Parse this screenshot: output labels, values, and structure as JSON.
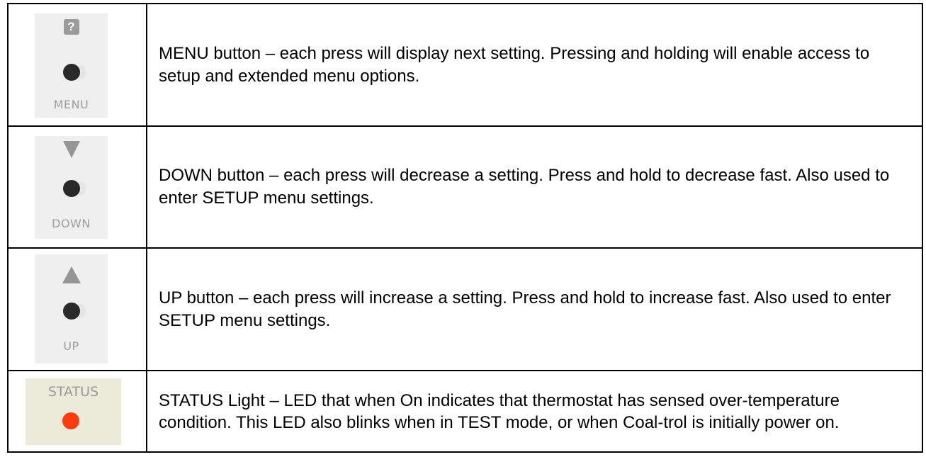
{
  "rows": [
    {
      "icon": "question-icon",
      "panel_label": "MENU",
      "description": "MENU button – each press will display next setting. Pressing and holding will enable access to setup and extended menu options."
    },
    {
      "icon": "down-triangle-icon",
      "panel_label": "DOWN",
      "description": "DOWN button – each press will decrease a setting. Press and hold to decrease fast. Also used to enter SETUP menu settings."
    },
    {
      "icon": "up-triangle-icon",
      "panel_label": "UP",
      "description": "UP button – each press will increase a setting. Press and hold to increase fast. Also used to enter SETUP menu settings."
    },
    {
      "icon": "status-led-icon",
      "panel_label": "STATUS",
      "led_color": "#ff3b12",
      "description": "STATUS Light – LED that when On indicates that thermostat has sensed over-temperature condition. This LED also blinks when in TEST mode, or when Coal-trol is initially power on."
    }
  ]
}
